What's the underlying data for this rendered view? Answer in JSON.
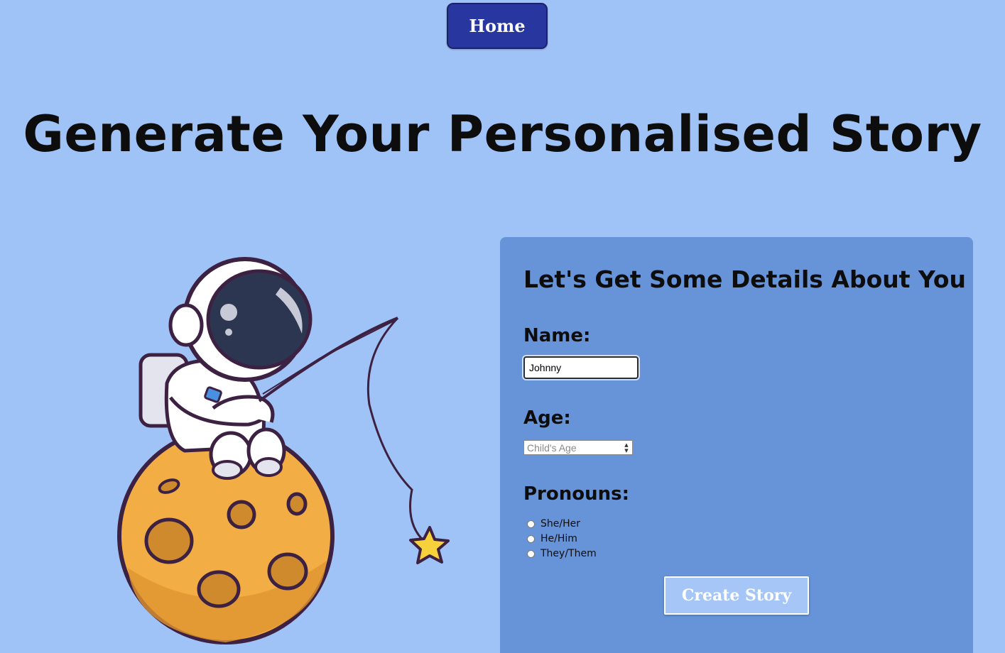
{
  "nav": {
    "home_label": "Home"
  },
  "page_title": "Generate Your Personalised Story",
  "form": {
    "title": "Let's Get Some Details About You",
    "name_label": "Name:",
    "name_value": "Johnny",
    "age_label": "Age:",
    "age_placeholder": "Child's Age",
    "pronouns_label": "Pronouns:",
    "pronouns": [
      "She/Her",
      "He/Him",
      "They/Them"
    ],
    "submit_label": "Create Story"
  },
  "illustration": {
    "icon": "astronaut-fishing-on-moon"
  },
  "colors": {
    "background": "#a0c3f7",
    "panel": "#6794d8",
    "home_button": "#27379f",
    "create_button": "#a5c6f6"
  }
}
